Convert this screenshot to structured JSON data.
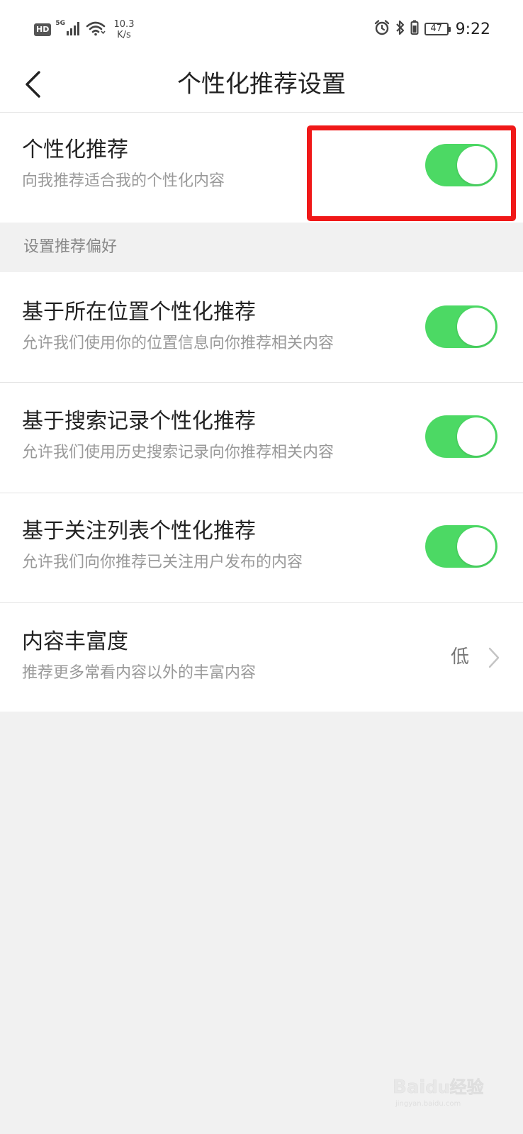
{
  "status_bar": {
    "hd_label": "HD",
    "network_label": "5G",
    "speed_value": "10.3",
    "speed_unit": "K/s",
    "battery_level": "47",
    "time": "9:22"
  },
  "header": {
    "title": "个性化推荐设置"
  },
  "main_setting": {
    "title": "个性化推荐",
    "subtitle": "向我推荐适合我的个性化内容",
    "enabled": true
  },
  "section": {
    "label": "设置推荐偏好"
  },
  "preferences": [
    {
      "title": "基于所在位置个性化推荐",
      "subtitle": "允许我们使用你的位置信息向你推荐相关内容",
      "enabled": true
    },
    {
      "title": "基于搜索记录个性化推荐",
      "subtitle": "允许我们使用历史搜索记录向你推荐相关内容",
      "enabled": true
    },
    {
      "title": "基于关注列表个性化推荐",
      "subtitle": "允许我们向你推荐已关注用户发布的内容",
      "enabled": true
    }
  ],
  "richness": {
    "title": "内容丰富度",
    "subtitle": "推荐更多常看内容以外的丰富内容",
    "value": "低"
  },
  "watermark": {
    "text": "Baidu经验",
    "subtext": "jingyan.baidu.com"
  },
  "colors": {
    "toggle_on": "#4cd964",
    "highlight": "#f01818",
    "background": "#f1f1f1"
  }
}
